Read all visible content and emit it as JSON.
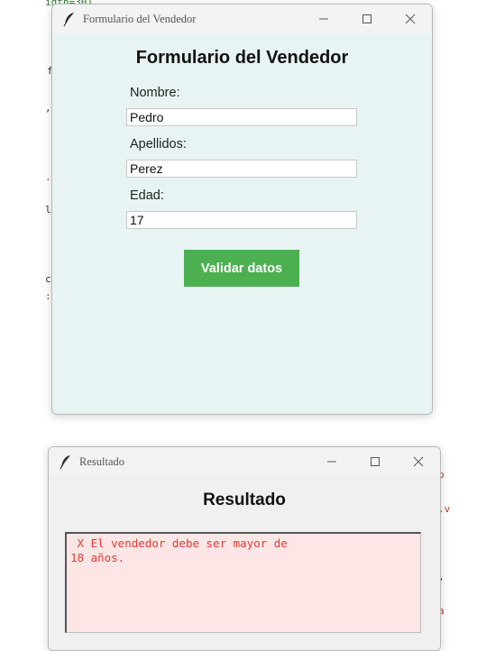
{
  "background": {
    "fragments": [
      "idth=30)",
      "f",
      ",",
      ".v",
      "lt",
      "c",
      ":a",
      "p",
      ".v",
      ",",
      "a"
    ]
  },
  "vendor_window": {
    "title": "Formulario del Vendedor",
    "heading": "Formulario del Vendedor",
    "fields": [
      {
        "label": "Nombre:",
        "value": "Pedro"
      },
      {
        "label": "Apellidos:",
        "value": "Perez"
      },
      {
        "label": "Edad:",
        "value": "17"
      }
    ],
    "button_label": "Validar datos"
  },
  "result_window": {
    "title": "Resultado",
    "heading": "Resultado",
    "message": " X El vendedor debe ser mayor de\n18 años."
  },
  "colors": {
    "form_bg": "#e8f4f4",
    "button_bg": "#4caf50",
    "result_bg": "#ffe6e6",
    "result_text": "#e53935"
  },
  "icons": {
    "app": "feather-icon",
    "minimize": "minimize-icon",
    "maximize": "maximize-icon",
    "close": "close-icon"
  }
}
